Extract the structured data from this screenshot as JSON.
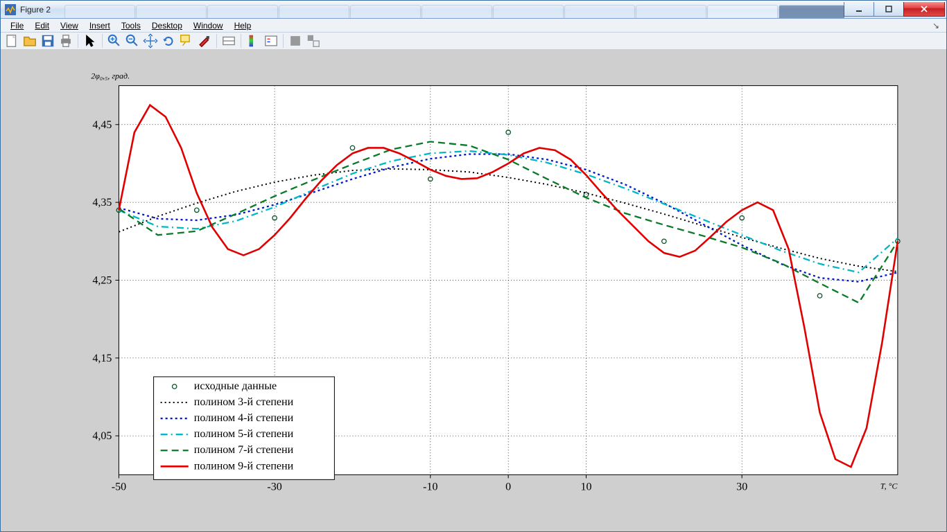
{
  "window": {
    "title": "Figure 2"
  },
  "menu": {
    "items": [
      "File",
      "Edit",
      "View",
      "Insert",
      "Tools",
      "Desktop",
      "Window",
      "Help"
    ]
  },
  "ylabel": "2φ₀,₅, град.",
  "xlabel": "T, °C",
  "legend": {
    "items": [
      "исходные данные",
      "полином 3-й степени",
      "полином 4-й степени",
      "полином 5-й степени",
      "полином 7-й степени",
      "полином 9-й степени"
    ]
  },
  "chart_data": {
    "type": "line",
    "xlabel": "T, °C",
    "ylabel": "2φ₀,₅, град.",
    "xlim": [
      -50,
      50
    ],
    "ylim": [
      4.0,
      4.5
    ],
    "xticks": [
      -50,
      -30,
      -10,
      0,
      10,
      30
    ],
    "yticks": [
      4.05,
      4.15,
      4.25,
      4.35,
      4.45
    ],
    "data_points": {
      "x": [
        -50,
        -40,
        -30,
        -20,
        -10,
        0,
        10,
        20,
        30,
        40,
        50
      ],
      "y": [
        4.34,
        4.34,
        4.33,
        4.42,
        4.38,
        4.44,
        4.36,
        4.3,
        4.33,
        4.23,
        4.3
      ]
    },
    "series": [
      {
        "name": "исходные данные",
        "style": "markers"
      },
      {
        "name": "полином 3-й степени",
        "style": "black-dot",
        "x": [
          -50,
          -45,
          -40,
          -35,
          -30,
          -25,
          -20,
          -15,
          -10,
          -5,
          0,
          5,
          10,
          15,
          20,
          25,
          30,
          35,
          40,
          45,
          50
        ],
        "y": [
          4.312,
          4.332,
          4.349,
          4.364,
          4.376,
          4.385,
          4.391,
          4.393,
          4.392,
          4.389,
          4.382,
          4.373,
          4.362,
          4.349,
          4.335,
          4.32,
          4.305,
          4.291,
          4.278,
          4.268,
          4.261
        ]
      },
      {
        "name": "полином 4-й степени",
        "style": "blue-dot",
        "x": [
          -50,
          -45,
          -40,
          -35,
          -30,
          -25,
          -20,
          -15,
          -10,
          -5,
          0,
          5,
          10,
          15,
          20,
          25,
          30,
          35,
          40,
          45,
          50
        ],
        "y": [
          4.343,
          4.329,
          4.327,
          4.334,
          4.347,
          4.363,
          4.38,
          4.395,
          4.406,
          4.412,
          4.412,
          4.405,
          4.392,
          4.373,
          4.349,
          4.322,
          4.295,
          4.271,
          4.253,
          4.248,
          4.26
        ]
      },
      {
        "name": "полином 5-й степени",
        "style": "cyan-dashdot",
        "x": [
          -50,
          -45,
          -40,
          -35,
          -30,
          -25,
          -20,
          -15,
          -10,
          -5,
          0,
          5,
          10,
          15,
          20,
          25,
          30,
          35,
          40,
          45,
          50
        ],
        "y": [
          4.34,
          4.319,
          4.316,
          4.326,
          4.344,
          4.366,
          4.387,
          4.403,
          4.413,
          4.416,
          4.411,
          4.401,
          4.386,
          4.368,
          4.348,
          4.328,
          4.308,
          4.288,
          4.271,
          4.26,
          4.304
        ]
      },
      {
        "name": "полином 7-й степени",
        "style": "green-dash",
        "x": [
          -50,
          -45,
          -40,
          -35,
          -30,
          -25,
          -20,
          -15,
          -10,
          -5,
          0,
          5,
          10,
          15,
          20,
          25,
          30,
          35,
          40,
          45,
          50
        ],
        "y": [
          4.342,
          4.308,
          4.313,
          4.335,
          4.358,
          4.379,
          4.399,
          4.418,
          4.428,
          4.423,
          4.405,
          4.38,
          4.356,
          4.336,
          4.321,
          4.307,
          4.292,
          4.272,
          4.246,
          4.221,
          4.3
        ]
      },
      {
        "name": "полином 9-й степени",
        "style": "red-solid",
        "x": [
          -50,
          -48,
          -46,
          -44,
          -42,
          -40,
          -38,
          -36,
          -34,
          -32,
          -30,
          -28,
          -26,
          -24,
          -22,
          -20,
          -18,
          -16,
          -14,
          -12,
          -10,
          -8,
          -6,
          -4,
          -2,
          0,
          2,
          4,
          6,
          8,
          10,
          12,
          14,
          16,
          18,
          20,
          22,
          24,
          26,
          28,
          30,
          32,
          34,
          36,
          38,
          40,
          42,
          44,
          46,
          48,
          50
        ],
        "y": [
          4.34,
          4.44,
          4.475,
          4.46,
          4.42,
          4.362,
          4.318,
          4.29,
          4.282,
          4.29,
          4.308,
          4.33,
          4.355,
          4.378,
          4.398,
          4.413,
          4.42,
          4.42,
          4.413,
          4.403,
          4.392,
          4.384,
          4.38,
          4.381,
          4.389,
          4.4,
          4.413,
          4.42,
          4.417,
          4.405,
          4.385,
          4.362,
          4.34,
          4.32,
          4.3,
          4.285,
          4.28,
          4.288,
          4.306,
          4.325,
          4.34,
          4.35,
          4.34,
          4.29,
          4.19,
          4.08,
          4.02,
          4.01,
          4.06,
          4.17,
          4.3
        ]
      }
    ]
  }
}
